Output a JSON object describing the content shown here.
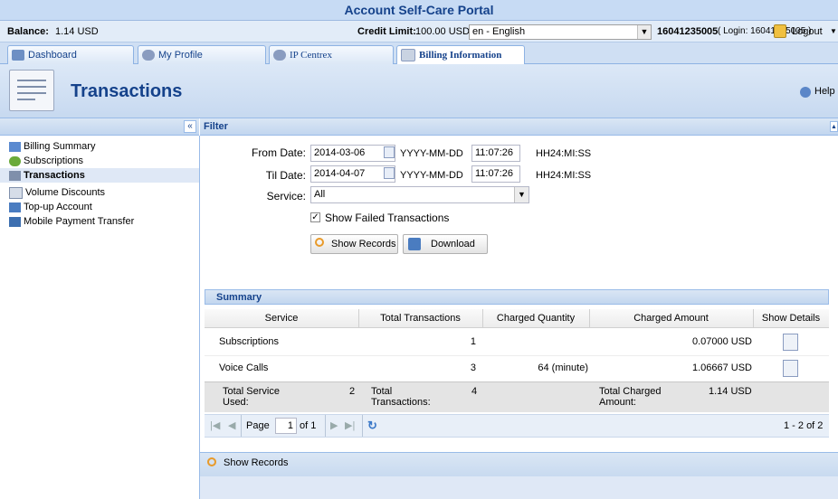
{
  "app": {
    "title": "Account Self-Care Portal"
  },
  "info": {
    "balance_label": "Balance:",
    "balance_value": "1.14 USD",
    "credit_label": "Credit Limit:",
    "credit_value": "100.00 USD",
    "language": "en - English",
    "account_id": "16041235005",
    "login_text": "( Login: 16041235005 )",
    "logout_label": "Logout"
  },
  "tabs": [
    {
      "label": "Dashboard"
    },
    {
      "label": "My Profile"
    },
    {
      "label": "IP Centrex"
    },
    {
      "label": "Billing Information"
    }
  ],
  "header": {
    "title": "Transactions",
    "help_label": "Help"
  },
  "sidebar": {
    "items": [
      {
        "label": "Billing Summary"
      },
      {
        "label": "Subscriptions"
      },
      {
        "label": "Transactions"
      },
      {
        "label": "Volume Discounts"
      },
      {
        "label": "Top-up Account"
      },
      {
        "label": "Mobile Payment Transfer"
      }
    ]
  },
  "filter": {
    "title": "Filter",
    "from_label": "From Date:",
    "from_date": "2014-03-06",
    "from_date_format": "YYYY-MM-DD",
    "from_time": "11:07:26",
    "from_time_format": "HH24:MI:SS",
    "till_label": "Til Date:",
    "till_date": "2014-04-07",
    "till_date_format": "YYYY-MM-DD",
    "till_time": "11:07:26",
    "till_time_format": "HH24:MI:SS",
    "service_label": "Service:",
    "service_value": "All",
    "show_failed_label": "Show Failed Transactions",
    "show_failed_checked": true,
    "show_records_label": "Show Records",
    "download_label": "Download"
  },
  "summary": {
    "title": "Summary",
    "columns": [
      "Service",
      "Total Transactions",
      "Charged Quantity",
      "Charged Amount",
      "Show Details"
    ],
    "rows": [
      {
        "service": "Subscriptions",
        "total_transactions": "1",
        "charged_quantity": "",
        "charged_amount": "0.07000 USD"
      },
      {
        "service": "Voice Calls",
        "total_transactions": "3",
        "charged_quantity": "64 (minute)",
        "charged_amount": "1.06667 USD"
      }
    ],
    "totals": {
      "service_used_label": "Total Service Used:",
      "service_used_value": "2",
      "transactions_label": "Total Transactions:",
      "transactions_value": "4",
      "charged_label": "Total Charged Amount:",
      "charged_value": "1.14 USD"
    }
  },
  "pager": {
    "page_label": "Page",
    "page_value": "1",
    "of_label": "of 1",
    "range_text": "1 - 2 of 2"
  },
  "bottom": {
    "show_records_label": "Show Records"
  },
  "colors": {
    "header_blue": "#15428b",
    "panel_blue": "#c7dbf4"
  }
}
